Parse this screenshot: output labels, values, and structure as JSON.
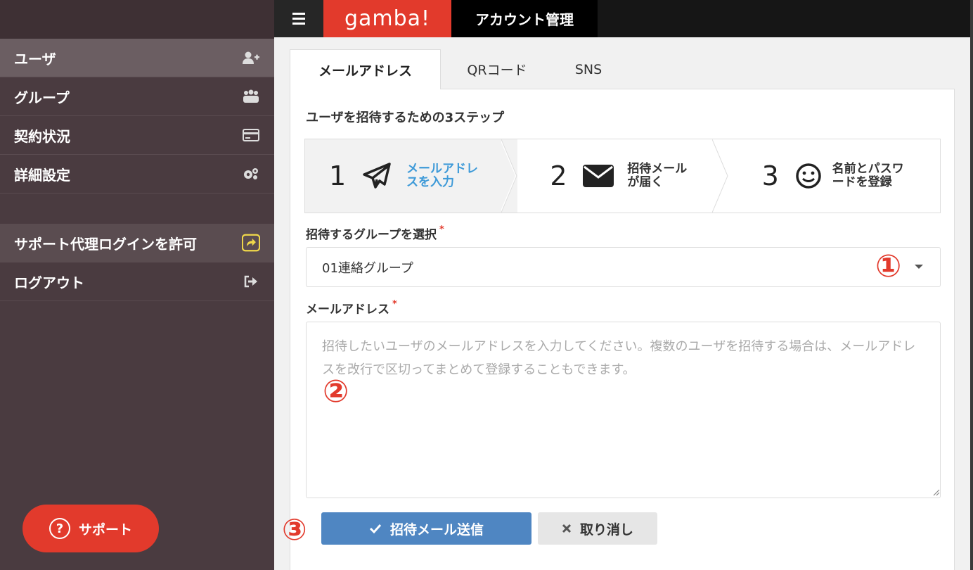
{
  "app": {
    "brand": "gamba!",
    "title": "アカウント管理"
  },
  "sidebar": {
    "items": [
      {
        "label": "ユーザ",
        "icon": "user-plus-icon"
      },
      {
        "label": "グループ",
        "icon": "group-icon"
      },
      {
        "label": "契約状況",
        "icon": "credit-card-icon"
      },
      {
        "label": "詳細設定",
        "icon": "gears-icon"
      }
    ],
    "support_login": {
      "label": "サポート代理ログインを許可",
      "icon": "share-square-icon"
    },
    "logout": {
      "label": "ログアウト",
      "icon": "sign-out-icon"
    },
    "support_button": {
      "label": "サポート",
      "icon_glyph": "?"
    }
  },
  "tabs": [
    "メールアドレス",
    "QRコード",
    "SNS"
  ],
  "panel": {
    "heading": "ユーザを招待するための3ステップ",
    "steps": [
      {
        "num": "1",
        "label": "メールアドレスを入力",
        "icon": "paper-plane-icon"
      },
      {
        "num": "2",
        "label": "招待メールが届く",
        "icon": "envelope-icon"
      },
      {
        "num": "3",
        "label": "名前とパスワードを登録",
        "icon": "smile-icon"
      }
    ],
    "group_field": {
      "label": "招待するグループを選択",
      "required_mark": "*",
      "value": "01連絡グループ"
    },
    "email_field": {
      "label": "メールアドレス",
      "required_mark": "*",
      "placeholder": "招待したいユーザのメールアドレスを入力してください。複数のユーザを招待する場合は、メールアドレスを改行で区切ってまとめて登録することもできます。"
    },
    "buttons": {
      "send": "招待メール送信",
      "cancel": "取り消し"
    }
  },
  "markers": [
    "①",
    "②",
    "③"
  ],
  "colors": {
    "brand_red": "#e23a2c",
    "sidebar_bg": "#4a3b40",
    "primary_blue": "#4f86c2",
    "step_active_text": "#3e9ad8"
  }
}
